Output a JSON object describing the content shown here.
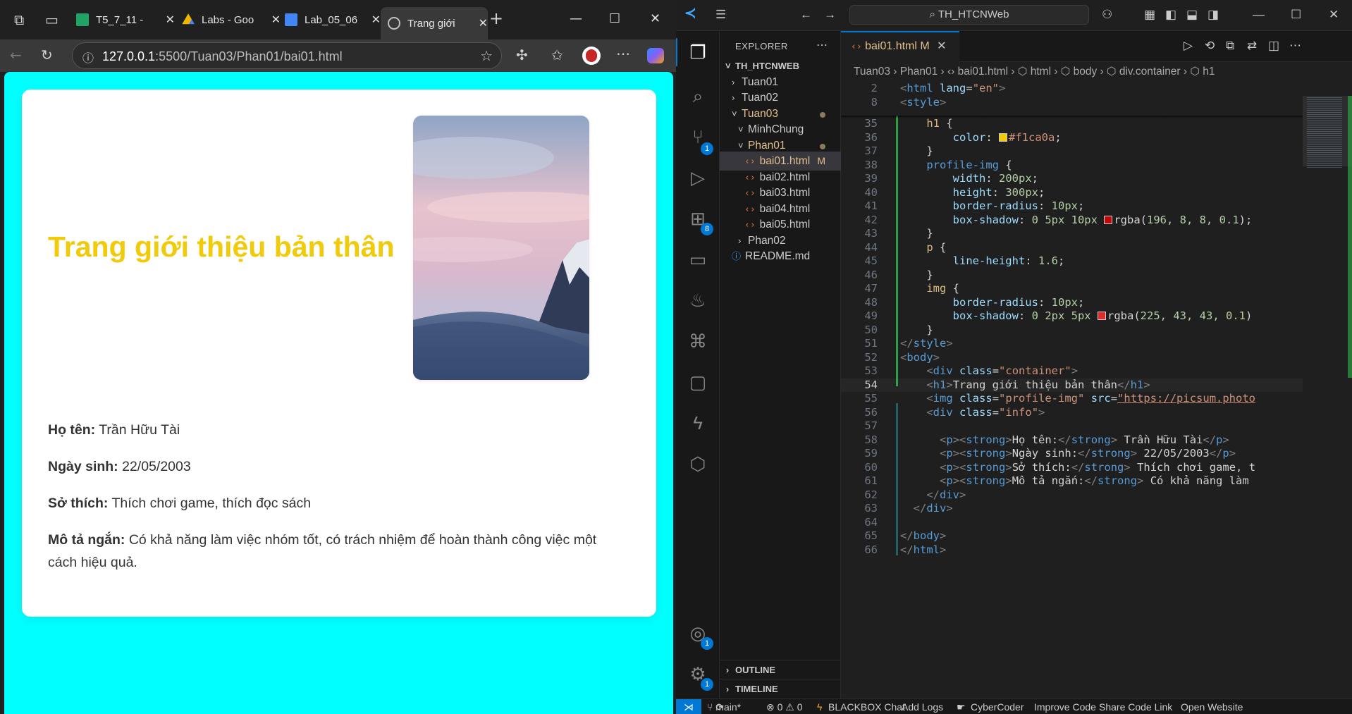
{
  "browser": {
    "tabs": [
      {
        "label": "T5_7_11 - ",
        "favicon_color": "#21a366"
      },
      {
        "label": "Labs - Goo",
        "favicon_color": "#f4b400"
      },
      {
        "label": "Lab_05_06",
        "favicon_color": "#4285f4"
      },
      {
        "label": "Trang giới",
        "favicon_color": "#c0c0c0"
      }
    ],
    "url_host": "127.0.0.1",
    "url_path": ":5500/Tuan03/Phan01/bai01.html"
  },
  "page": {
    "background": "#00ffff",
    "heading": "Trang giới thiệu bản thân",
    "heading_color": "#f1ca0a",
    "info": [
      {
        "label": "Họ tên:",
        "value": " Trần Hữu Tài"
      },
      {
        "label": "Ngày sinh:",
        "value": " 22/05/2003"
      },
      {
        "label": "Sở thích:",
        "value": " Thích chơi game, thích đọc sách"
      },
      {
        "label": "Mô tả ngắn:",
        "value": " Có khả năng làm việc nhóm tốt, có trách nhiệm để hoàn thành công việc một cách hiệu quả."
      }
    ]
  },
  "vscode": {
    "search": "TH_HTCNWeb",
    "explorer_title": "EXPLORER",
    "tree": [
      {
        "label": "TH_HTCNWEB",
        "type": "root",
        "indent": 0,
        "chev": "˅"
      },
      {
        "label": "Tuan01",
        "type": "folder",
        "indent": 1,
        "chev": "›"
      },
      {
        "label": "Tuan02",
        "type": "folder",
        "indent": 1,
        "chev": "›"
      },
      {
        "label": "Tuan03",
        "type": "folder-mod",
        "indent": 1,
        "chev": "˅"
      },
      {
        "label": "MinhChung",
        "type": "folder",
        "indent": 2,
        "chev": "˅"
      },
      {
        "label": "Phan01",
        "type": "folder-mod",
        "indent": 2,
        "chev": "˅"
      },
      {
        "label": "bai01.html",
        "type": "file-sel",
        "indent": 3,
        "mark": "M"
      },
      {
        "label": "bai02.html",
        "type": "file",
        "indent": 3
      },
      {
        "label": "bai03.html",
        "type": "file",
        "indent": 3
      },
      {
        "label": "bai04.html",
        "type": "file",
        "indent": 3
      },
      {
        "label": "bai05.html",
        "type": "file",
        "indent": 3
      },
      {
        "label": "Phan02",
        "type": "folder",
        "indent": 2,
        "chev": "›"
      },
      {
        "label": "README.md",
        "type": "readme",
        "indent": 1
      }
    ],
    "outline": "OUTLINE",
    "timeline": "TIMELINE",
    "editor_tab": "bai01.html",
    "editor_tab_mark": "M",
    "breadcrumb": "Tuan03 › Phan01 › ‹› bai01.html › ⬡ html › ⬡ body › ⬡ div.container › ⬡ h1",
    "code_lines": [
      {
        "n": "2",
        "html": "<span class='t-br'>&lt;</span><span class='t-tag'>html</span> <span class='t-attr'>lang</span>=<span class='t-str'>\"en\"</span><span class='t-br'>&gt;</span>"
      },
      {
        "n": "8",
        "html": "<span class='t-br'>&lt;</span><span class='t-tag'>style</span><span class='t-br'>&gt;</span>"
      },
      {
        "n": "35",
        "html": "    <span class='t-sel'>h1</span> {"
      },
      {
        "n": "36",
        "html": "        <span class='t-prop'>color</span>: <span class='swatch' style='background:#f1ca0a'></span><span class='t-str'>#f1ca0a</span>;"
      },
      {
        "n": "37",
        "html": "    }"
      },
      {
        "n": "38",
        "html": "    <span class='t-sel2'>profile-img</span> {"
      },
      {
        "n": "39",
        "html": "        <span class='t-prop'>width</span>: <span class='t-num'>200px</span>;"
      },
      {
        "n": "40",
        "html": "        <span class='t-prop'>height</span>: <span class='t-num'>300px</span>;"
      },
      {
        "n": "41",
        "html": "        <span class='t-prop'>border-radius</span>: <span class='t-num'>10px</span>;"
      },
      {
        "n": "42",
        "html": "        <span class='t-prop'>box-shadow</span>: <span class='t-num'>0 5px 10px</span> <span class='swatch' style='background:#c40808'></span><span class='t-txt'>rgba(</span><span class='t-num'>196, 8, 8, 0.1</span><span class='t-txt'>);</span>"
      },
      {
        "n": "43",
        "html": "    }"
      },
      {
        "n": "44",
        "html": "    <span class='t-sel'>p</span> {"
      },
      {
        "n": "45",
        "html": "        <span class='t-prop'>line-height</span>: <span class='t-num'>1.6</span>;"
      },
      {
        "n": "46",
        "html": "    }"
      },
      {
        "n": "47",
        "html": "    <span class='t-sel'>img</span> {"
      },
      {
        "n": "48",
        "html": "        <span class='t-prop'>border-radius</span>: <span class='t-num'>10px</span>;"
      },
      {
        "n": "49",
        "html": "        <span class='t-prop'>box-shadow</span>: <span class='t-num'>0 2px 5px</span> <span class='swatch' style='background:#e12b2b'></span><span class='t-txt'>rgba(</span><span class='t-num'>225, 43, 43, 0.1</span><span class='t-txt'>)</span>"
      },
      {
        "n": "50",
        "html": "    }"
      },
      {
        "n": "51",
        "html": "<span class='t-br'>&lt;/</span><span class='t-tag'>style</span><span class='t-br'>&gt;</span>"
      },
      {
        "n": "52",
        "html": "<span class='t-br'>&lt;</span><span class='t-tag'>body</span><span class='t-br'>&gt;</span>"
      },
      {
        "n": "53",
        "html": "    <span class='t-br'>&lt;</span><span class='t-tag'>div</span> <span class='t-attr'>class</span>=<span class='t-str'>\"container\"</span><span class='t-br'>&gt;</span>"
      },
      {
        "n": "54",
        "html": "    <span class='t-br'>&lt;</span><span class='t-tag'>h1</span><span class='t-br'>&gt;</span>Trang giới thiệu bản thân<span class='t-br'>&lt;/</span><span class='t-tag'>h1</span><span class='t-br'>&gt;</span>"
      },
      {
        "n": "55",
        "html": "    <span class='t-br'>&lt;</span><span class='t-tag'>img</span> <span class='t-attr'>class</span>=<span class='t-str'>\"profile-img\"</span> <span class='t-attr'>src</span>=<span class='t-str' style='text-decoration:underline'>\"https://picsum.photo</span>"
      },
      {
        "n": "56",
        "html": "    <span class='t-br'>&lt;</span><span class='t-tag'>div</span> <span class='t-attr'>class</span>=<span class='t-str'>\"info\"</span><span class='t-br'>&gt;</span>"
      },
      {
        "n": "57",
        "html": ""
      },
      {
        "n": "58",
        "html": "      <span class='t-br'>&lt;</span><span class='t-tag'>p</span><span class='t-br'>&gt;&lt;</span><span class='t-tag'>strong</span><span class='t-br'>&gt;</span>Họ tên:<span class='t-br'>&lt;/</span><span class='t-tag'>strong</span><span class='t-br'>&gt;</span> Trần Hữu Tài<span class='t-br'>&lt;/</span><span class='t-tag'>p</span><span class='t-br'>&gt;</span>"
      },
      {
        "n": "59",
        "html": "      <span class='t-br'>&lt;</span><span class='t-tag'>p</span><span class='t-br'>&gt;&lt;</span><span class='t-tag'>strong</span><span class='t-br'>&gt;</span>Ngày sinh:<span class='t-br'>&lt;/</span><span class='t-tag'>strong</span><span class='t-br'>&gt;</span> 22/05/2003<span class='t-br'>&lt;/</span><span class='t-tag'>p</span><span class='t-br'>&gt;</span>"
      },
      {
        "n": "60",
        "html": "      <span class='t-br'>&lt;</span><span class='t-tag'>p</span><span class='t-br'>&gt;&lt;</span><span class='t-tag'>strong</span><span class='t-br'>&gt;</span>Sở thích:<span class='t-br'>&lt;/</span><span class='t-tag'>strong</span><span class='t-br'>&gt;</span> Thích chơi game, t"
      },
      {
        "n": "61",
        "html": "      <span class='t-br'>&lt;</span><span class='t-tag'>p</span><span class='t-br'>&gt;&lt;</span><span class='t-tag'>strong</span><span class='t-br'>&gt;</span>Mô tả ngắn:<span class='t-br'>&lt;/</span><span class='t-tag'>strong</span><span class='t-br'>&gt;</span> Có khả năng làm"
      },
      {
        "n": "62",
        "html": "    <span class='t-br'>&lt;/</span><span class='t-tag'>div</span><span class='t-br'>&gt;</span>"
      },
      {
        "n": "63",
        "html": "  <span class='t-br'>&lt;/</span><span class='t-tag'>div</span><span class='t-br'>&gt;</span>"
      },
      {
        "n": "64",
        "html": ""
      },
      {
        "n": "65",
        "html": "<span class='t-br'>&lt;/</span><span class='t-tag'>body</span><span class='t-br'>&gt;</span>"
      },
      {
        "n": "66",
        "html": "<span class='t-br'>&lt;/</span><span class='t-tag'>html</span><span class='t-br'>&gt;</span>"
      }
    ],
    "current_line": "54",
    "badges": {
      "scm": "1",
      "extensions": "8",
      "account": "1",
      "settings": "1"
    },
    "status": {
      "branch": "main*",
      "problems": "⊗ 0 ⚠ 0",
      "blackbox": "BLACKBOX Chat",
      "addlogs": "Add Logs",
      "cybercoder": "CyberCoder",
      "improve": "Improve Code",
      "share": "Share Code Link",
      "open": "Open Website"
    }
  }
}
